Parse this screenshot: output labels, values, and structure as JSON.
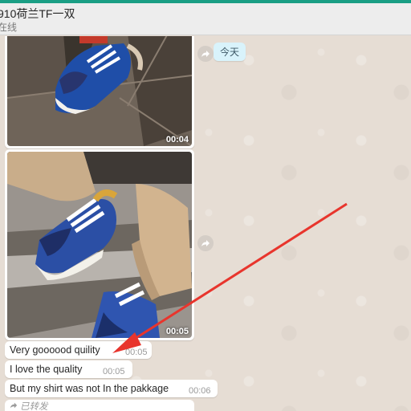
{
  "header": {
    "title": "910荷兰TF一双",
    "status": "在线"
  },
  "chat": {
    "date_chip": "今天",
    "media": [
      {
        "duration": "00:04"
      },
      {
        "duration": "00:05"
      }
    ],
    "messages": [
      {
        "text": "Very goooood quility",
        "time": "00:05"
      },
      {
        "text": "I love the quality",
        "time": "00:05"
      },
      {
        "text": "But my shirt was not In the pakkage",
        "time": "00:06"
      }
    ],
    "forwarded_label": "已转发"
  },
  "colors": {
    "accent": "#1a9e84",
    "chat_bg": "#e6ddd4",
    "date_chip_bg": "#d9f3fb",
    "annotation_arrow": "#e8352d"
  },
  "icons": [
    "forward-icon",
    "forward-icon",
    "forward-small-icon"
  ]
}
